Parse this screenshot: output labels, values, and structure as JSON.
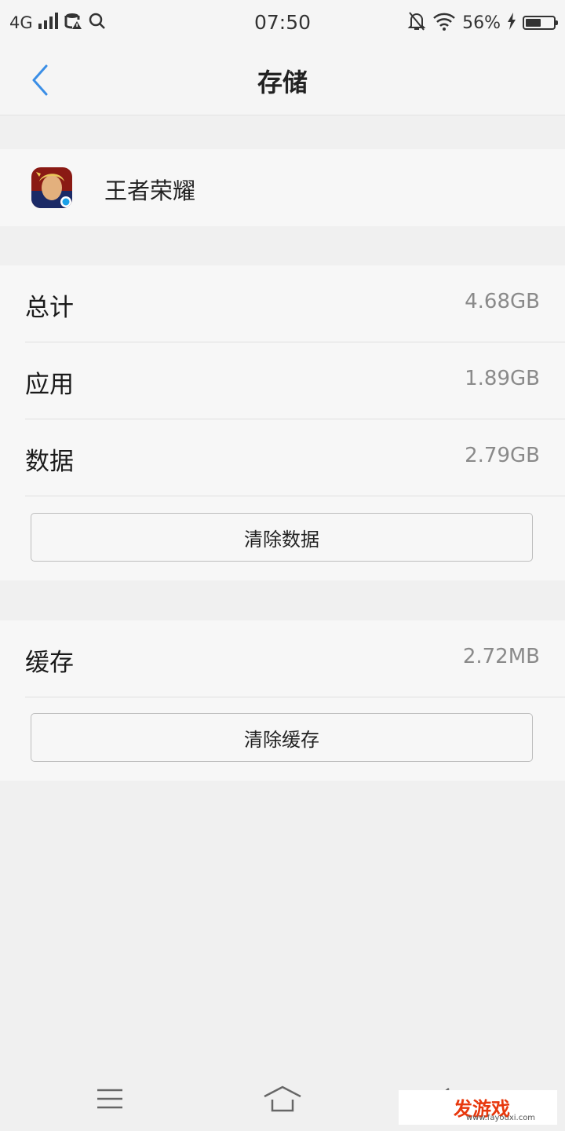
{
  "status_bar": {
    "network": "4G",
    "time": "07:50",
    "battery_percent": "56%",
    "battery_level": 0.56,
    "icons": [
      "signal-icon",
      "database-warning-icon",
      "search-icon",
      "mute-bell-icon",
      "wifi-icon",
      "charging-icon",
      "battery-icon"
    ]
  },
  "header": {
    "title": "存储",
    "back_icon": "chevron-left-icon"
  },
  "app": {
    "name": "王者荣耀",
    "icon": "app-icon"
  },
  "storage": {
    "rows": [
      {
        "label": "总计",
        "value": "4.68GB"
      },
      {
        "label": "应用",
        "value": "1.89GB"
      },
      {
        "label": "数据",
        "value": "2.79GB"
      }
    ],
    "clear_data_label": "清除数据"
  },
  "cache": {
    "label": "缓存",
    "value": "2.72MB",
    "clear_cache_label": "清除缓存"
  },
  "bottom_nav": {
    "icons": [
      "menu-icon",
      "home-icon",
      "back-icon"
    ]
  },
  "watermark": {
    "text": "发游戏",
    "url": "www.fayouxi.com"
  },
  "colors": {
    "accent": "#3a8ee6",
    "background": "#f0f0f0",
    "card": "#f7f7f7"
  }
}
